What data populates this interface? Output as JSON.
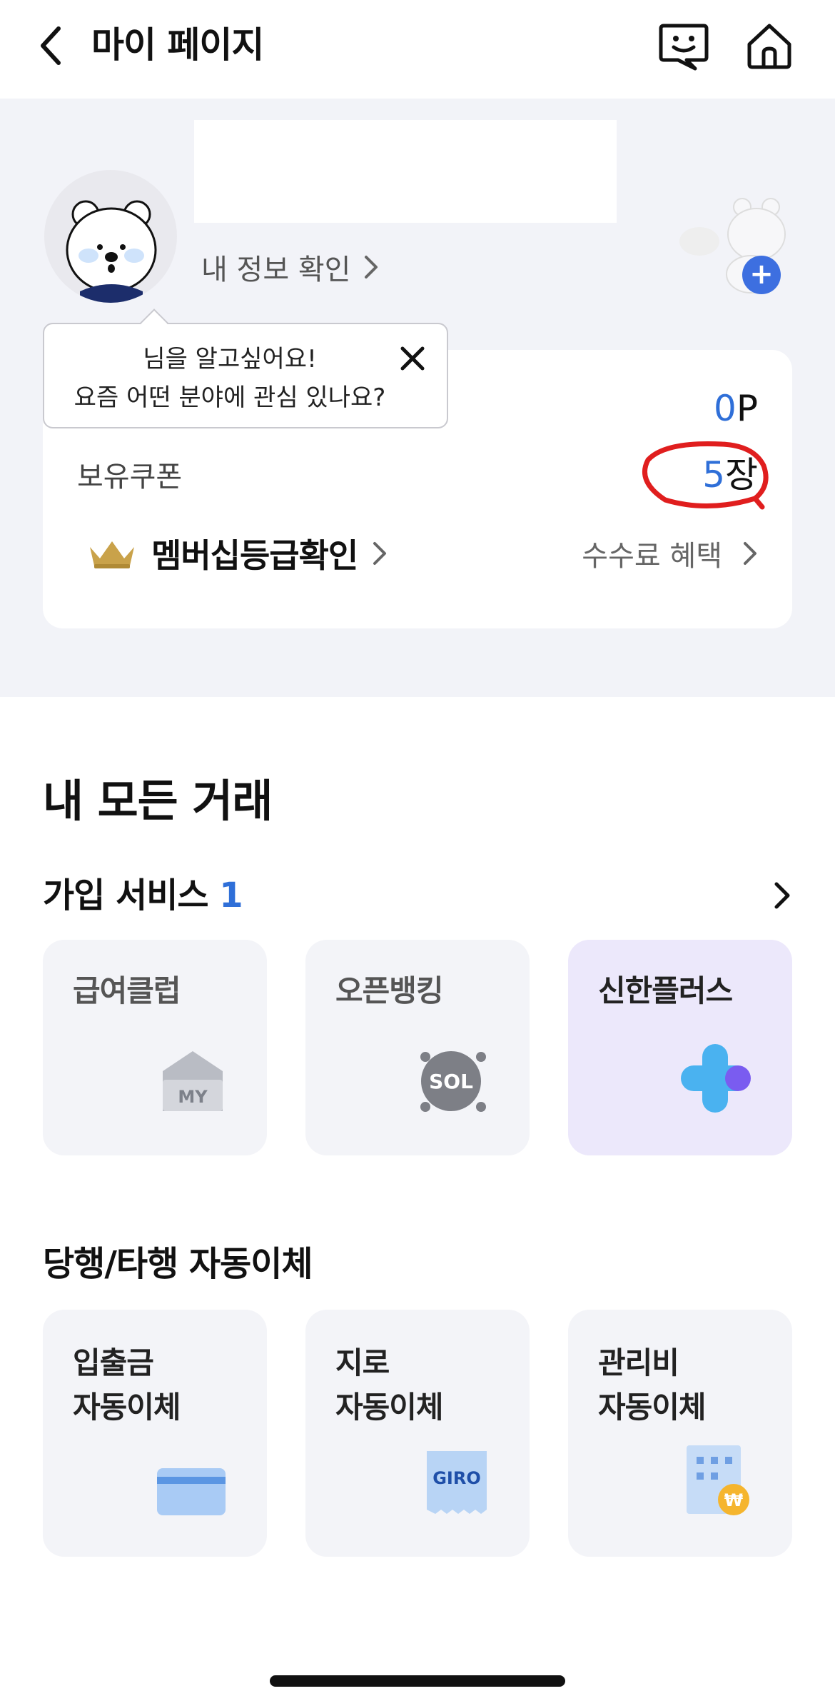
{
  "header": {
    "title": "마이 페이지",
    "back_icon": "chevron-left-icon",
    "chat_icon": "chat-bot-icon",
    "home_icon": "home-icon"
  },
  "profile": {
    "my_info_label": "내 정보 확인",
    "add_badge": "+"
  },
  "tooltip": {
    "line1": "님을 알고싶어요!",
    "line2": "요즘 어떤 분야에 관심 있나요?"
  },
  "card": {
    "point_number": "0",
    "point_unit": "P",
    "coupon_label": "보유쿠폰",
    "coupon_number": "5",
    "coupon_unit": "장",
    "membership_label": "멤버십등급확인",
    "fee_label": "수수료 혜택"
  },
  "transactions": {
    "title": "내 모든 거래",
    "joined_label": "가입 서비스",
    "joined_count": "1",
    "services": [
      {
        "label": "급여클럽",
        "icon": "mail-my-icon"
      },
      {
        "label": "오픈뱅킹",
        "icon": "sol-icon"
      },
      {
        "label": "신한플러스",
        "icon": "shinhan-plus-icon"
      }
    ],
    "auto_title": "당행/타행 자동이체",
    "auto": [
      {
        "line1": "입출금",
        "line2": "자동이체",
        "icon": "card-icon"
      },
      {
        "line1": "지로",
        "line2": "자동이체",
        "icon": "giro-icon",
        "icon_text": "GIRO"
      },
      {
        "line1": "관리비",
        "line2": "자동이체",
        "icon": "building-won-icon",
        "icon_text": "₩"
      }
    ]
  },
  "colors": {
    "accent": "#2f6fd8",
    "profile_bg": "#f2f3f8",
    "active_tile": "#ece8fb"
  }
}
